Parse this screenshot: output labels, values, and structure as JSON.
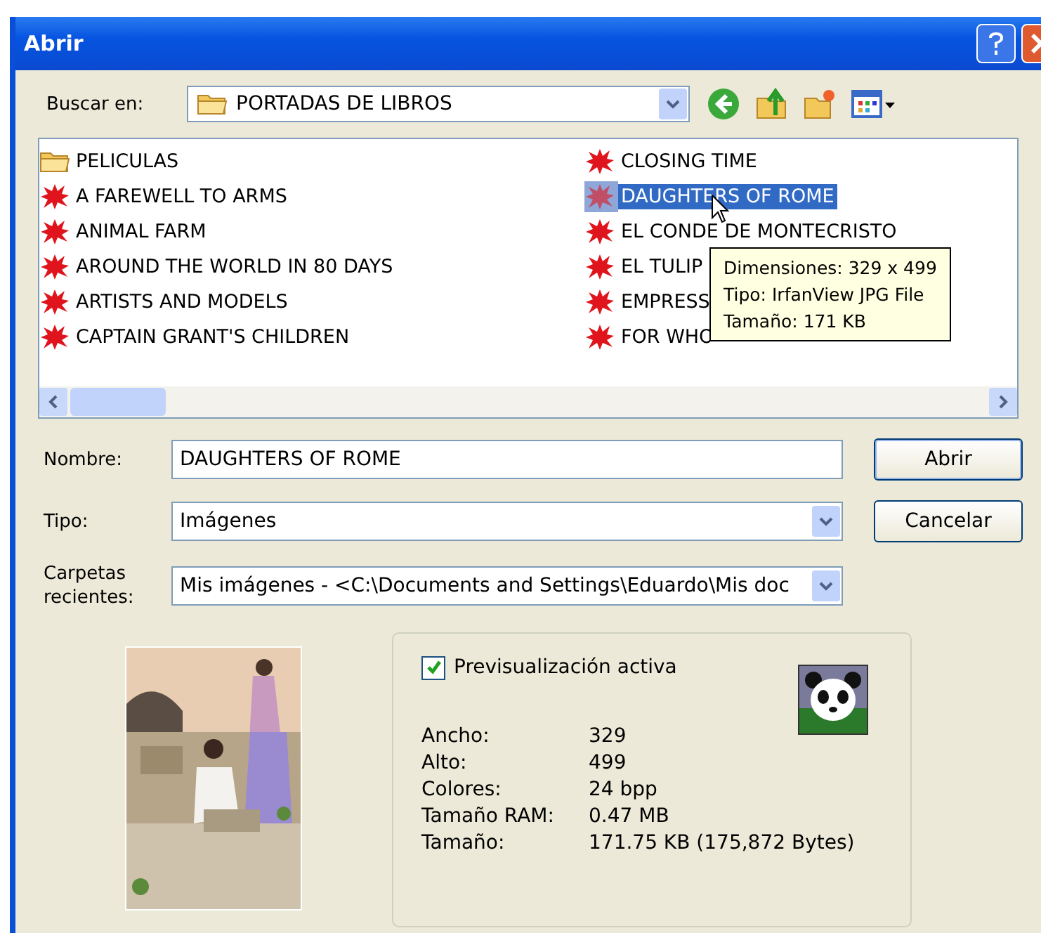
{
  "window": {
    "title": "Abrir"
  },
  "look_in": {
    "label": "Buscar en:",
    "value": "PORTADAS DE LIBROS"
  },
  "files": [
    {
      "name": "PELICULAS",
      "kind": "folder",
      "selected": false
    },
    {
      "name": "A FAREWELL TO ARMS",
      "selected": false
    },
    {
      "name": "ANIMAL FARM",
      "selected": false
    },
    {
      "name": "AROUND THE WORLD IN 80 DAYS",
      "selected": false
    },
    {
      "name": "ARTISTS AND MODELS",
      "selected": false
    },
    {
      "name": "CAPTAIN GRANT'S CHILDREN",
      "selected": false
    },
    {
      "name": "CLOSING TIME",
      "selected": false
    },
    {
      "name": "DAUGHTERS OF ROME",
      "selected": true
    },
    {
      "name": "EL CONDE DE MONTECRISTO",
      "selected": false
    },
    {
      "name": "EL TULIP",
      "selected": false
    },
    {
      "name": "EMPRESS",
      "selected": false
    },
    {
      "name": "FOR WHO",
      "selected": false
    }
  ],
  "tooltip": [
    "Dimensiones: 329 x 499",
    "Tipo: IrfanView JPG File",
    "Tamaño: 171 KB"
  ],
  "fields": [
    {
      "label": "Nombre:",
      "value": "DAUGHTERS OF ROME",
      "kind": "text",
      "button": "Abrir"
    },
    {
      "label": "Tipo:",
      "value": "Imágenes",
      "kind": "combo",
      "button": "Cancelar"
    },
    {
      "label": "Carpetas recientes:",
      "value": "Mis imágenes  -  <C:\\Documents and Settings\\Eduardo\\Mis doc",
      "kind": "combo"
    }
  ],
  "preview": {
    "checkbox": {
      "label": "Previsualización activa",
      "checked": true
    },
    "properties": [
      {
        "label": "Ancho:",
        "value": "329"
      },
      {
        "label": "Alto:",
        "value": "499"
      },
      {
        "label": "Colores:",
        "value": "24 bpp"
      },
      {
        "label": "Tamaño RAM:",
        "value": "0.47 MB"
      },
      {
        "label": "Tamaño:",
        "value": "171.75 KB (175,872 Bytes)"
      }
    ]
  }
}
